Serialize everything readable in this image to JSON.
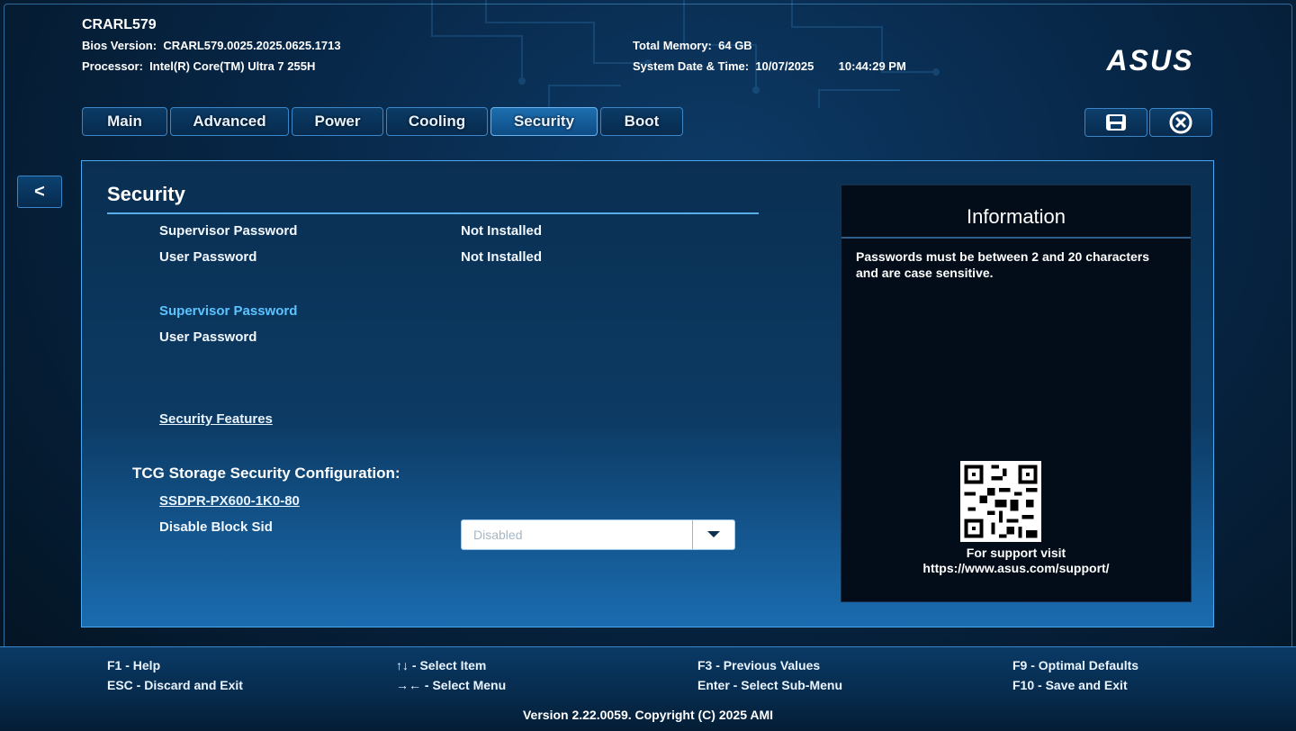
{
  "header": {
    "title": "CRARL579",
    "bios_version_label": "Bios Version:",
    "bios_version": "CRARL579.0025.2025.0625.1713",
    "processor_label": "Processor:",
    "processor": "Intel(R) Core(TM) Ultra 7 255H",
    "total_memory_label": "Total Memory:",
    "total_memory": "64 GB",
    "datetime_label": "System Date & Time:",
    "date": "10/07/2025",
    "time": "10:44:29 PM"
  },
  "logo": "ASUS",
  "tabs": [
    {
      "label": "Main"
    },
    {
      "label": "Advanced"
    },
    {
      "label": "Power"
    },
    {
      "label": "Cooling"
    },
    {
      "label": "Security"
    },
    {
      "label": "Boot"
    }
  ],
  "active_tab": "Security",
  "toolbar": {
    "save_icon": "save-icon",
    "exit_icon": "close-circle-icon"
  },
  "back_label": "<",
  "section": {
    "title": "Security",
    "status": [
      {
        "label": "Supervisor Password",
        "value": "Not Installed"
      },
      {
        "label": "User Password",
        "value": "Not Installed"
      }
    ],
    "set_supervisor": "Supervisor Password",
    "set_user": "User Password",
    "features_link": "Security Features",
    "tcg_heading": "TCG Storage Security Configuration:",
    "drive_link": "SSDPR-PX600-1K0-80",
    "block_sid_label": "Disable Block Sid",
    "block_sid_value": "Disabled"
  },
  "info": {
    "title": "Information",
    "text": "Passwords must be between 2 and 20 characters and are case sensitive.",
    "support_line1": "For support visit",
    "support_line2": "https://www.asus.com/support/"
  },
  "footer": {
    "keys": [
      {
        "key": "F1",
        "action": " - Help"
      },
      {
        "key": "ESC",
        "action": " - Discard and Exit"
      },
      {
        "key": "↑↓",
        "action": " - Select Item"
      },
      {
        "key": "→←",
        "action": " - Select Menu"
      },
      {
        "key": "F3",
        "action": " - Previous Values"
      },
      {
        "key": "Enter",
        "action": " - Select Sub-Menu"
      },
      {
        "key": "F9",
        "action": " - Optimal Defaults"
      },
      {
        "key": "F10",
        "action": " - Save and Exit"
      }
    ],
    "version": "Version 2.22.0059. Copyright (C) 2025 AMI"
  },
  "colors": {
    "accent": "#4aa9ee",
    "highlight": "#5cc3ff",
    "info_bg": "#030d19"
  }
}
